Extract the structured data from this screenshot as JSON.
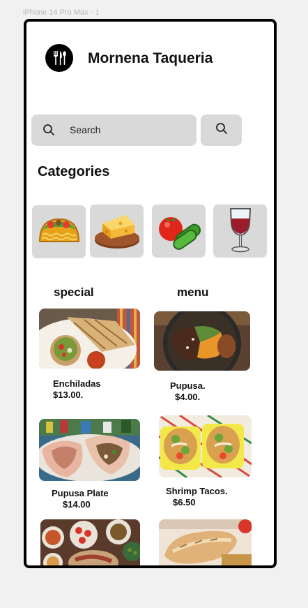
{
  "frame_label": "iPhone 14 Pro Max - 1",
  "app": {
    "title": "Mornena Taqueria",
    "logo_icon": "fork-knife-spoon-icon"
  },
  "search": {
    "placeholder": "Search",
    "icon": "search-icon",
    "button_icon": "search-icon"
  },
  "categories": {
    "title": "Categories",
    "items": [
      {
        "name": "taco",
        "icon": "taco-icon"
      },
      {
        "name": "cheese",
        "icon": "cheese-icon"
      },
      {
        "name": "vegetables",
        "icon": "tomato-cucumber-icon"
      },
      {
        "name": "wine",
        "icon": "wine-glass-icon"
      }
    ]
  },
  "columns": {
    "left": "special",
    "right": "menu"
  },
  "items": [
    {
      "name": "Enchiladas",
      "price": "$13.00."
    },
    {
      "name": "Pupusa.",
      "price": "$4.00."
    },
    {
      "name": "Pupusa Plate",
      "price": "$14.00"
    },
    {
      "name": "Shrimp Tacos.",
      "price": "$6.50"
    },
    {
      "name": "",
      "price": ""
    },
    {
      "name": "",
      "price": ""
    }
  ],
  "colors": {
    "phone_border": "#000000",
    "tile_bg": "#d9d9d9",
    "page_bg": "#f1f1f1"
  }
}
